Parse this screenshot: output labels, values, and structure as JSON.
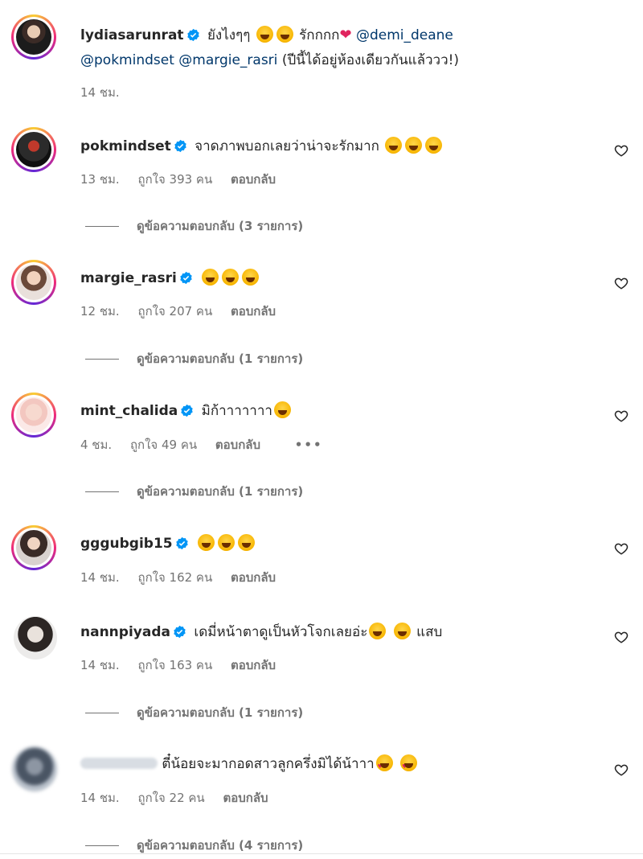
{
  "caption": {
    "username": "lydiasarunrat",
    "text_a": "ยังไงๆๆ",
    "text_b": "รักกกก",
    "mention1": "@demi_deane",
    "mention2": "@pokmindset",
    "mention3": "@margie_rasri",
    "text_c": "(ปีนี้ได้อยู่ห้องเดียวกันแล้ววว!)",
    "time": "14 ชม."
  },
  "labels": {
    "reply": "ตอบกลับ"
  },
  "comments": [
    {
      "username": "pokmindset",
      "text": "จาดภาพบอกเลยว่าน่าจะรักมาก",
      "time": "13 ชม.",
      "likes": "ถูกใจ 393 คน",
      "replies": "ดูข้อความตอบกลับ (3 รายการ)"
    },
    {
      "username": "margie_rasri",
      "text": "",
      "time": "12 ชม.",
      "likes": "ถูกใจ 207 คน",
      "replies": "ดูข้อความตอบกลับ (1 รายการ)"
    },
    {
      "username": "mint_chalida",
      "text": "มิก้าาาาาาา",
      "time": "4 ชม.",
      "likes": "ถูกใจ 49 คน",
      "more": "•••",
      "replies": "ดูข้อความตอบกลับ (1 รายการ)"
    },
    {
      "username": "gggubgib15",
      "text": "",
      "time": "14 ชม.",
      "likes": "ถูกใจ 162 คน"
    },
    {
      "username": "nannpiyada",
      "text": "เดมี่หน้าตาดูเป็นหัวโจกเลยอ่ะ",
      "text_after": "แสบ",
      "time": "14 ชม.",
      "likes": "ถูกใจ 163 คน",
      "replies": "ดูข้อความตอบกลับ (1 รายการ)"
    },
    {
      "username": "",
      "text": "ตี๋น้อยจะมากอดสาวลูกครึ่งมิได้น้าาา",
      "time": "14 ชม.",
      "likes": "ถูกใจ 22 คน",
      "replies": "ดูข้อความตอบกลับ (4 รายการ)"
    }
  ],
  "colors": {
    "link": "#00376b",
    "muted": "#737373",
    "verified": "#0095f6"
  },
  "icons": {
    "like": "heart-outline-icon",
    "verified": "verified-badge-icon"
  }
}
